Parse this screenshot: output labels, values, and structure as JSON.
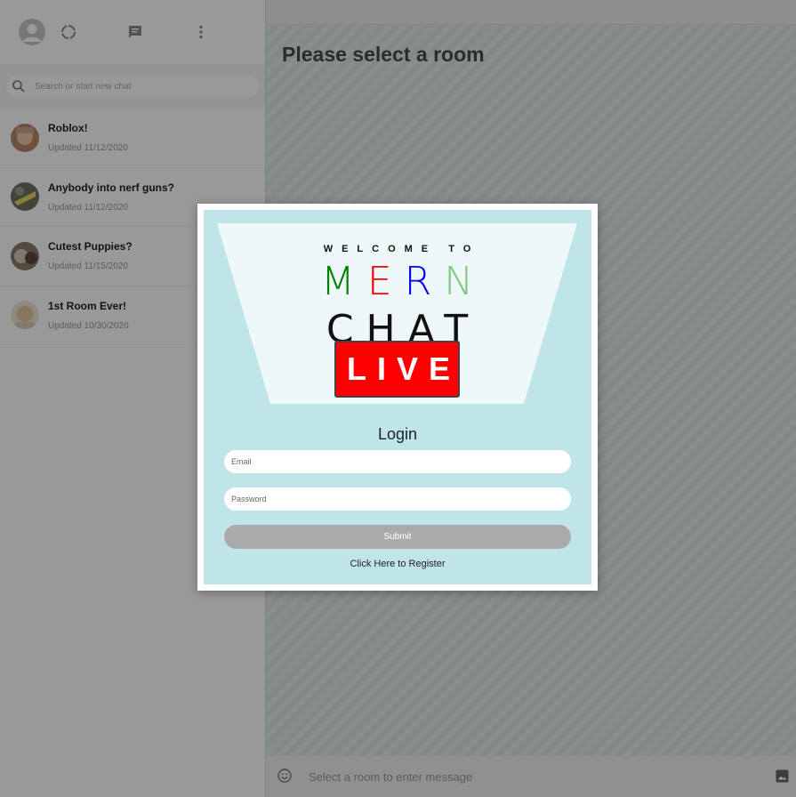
{
  "sidebar": {
    "search": {
      "placeholder": "Search or start new chat"
    },
    "rooms": [
      {
        "name": "Roblox!",
        "updated": "Updated 11/12/2020",
        "avatar_color": "#c49a7a"
      },
      {
        "name": "Anybody into nerf guns?",
        "updated": "Updated 11/12/2020",
        "avatar_color": "#8a8a60"
      },
      {
        "name": "Cutest Puppies?",
        "updated": "Updated 11/15/2020",
        "avatar_color": "#9b8a78"
      },
      {
        "name": "1st Room Ever!",
        "updated": "Updated 10/30/2020",
        "avatar_color": "#e0d3b8"
      }
    ]
  },
  "main": {
    "title": "Please select a room",
    "message_placeholder": "Select a room to enter message"
  },
  "modal": {
    "welcome": "WELCOME TO",
    "mern": {
      "m": "M",
      "e": "E",
      "r": "R",
      "n": "N"
    },
    "colors": {
      "m": "#008000",
      "e": "#ff0000",
      "r": "#0000ff",
      "n": "#7ec87e"
    },
    "chat": "CHAT",
    "live": "LIVE",
    "login_title": "Login",
    "email_placeholder": "Email",
    "password_placeholder": "Password",
    "submit_label": "Submit",
    "register_link": "Click Here to Register"
  }
}
